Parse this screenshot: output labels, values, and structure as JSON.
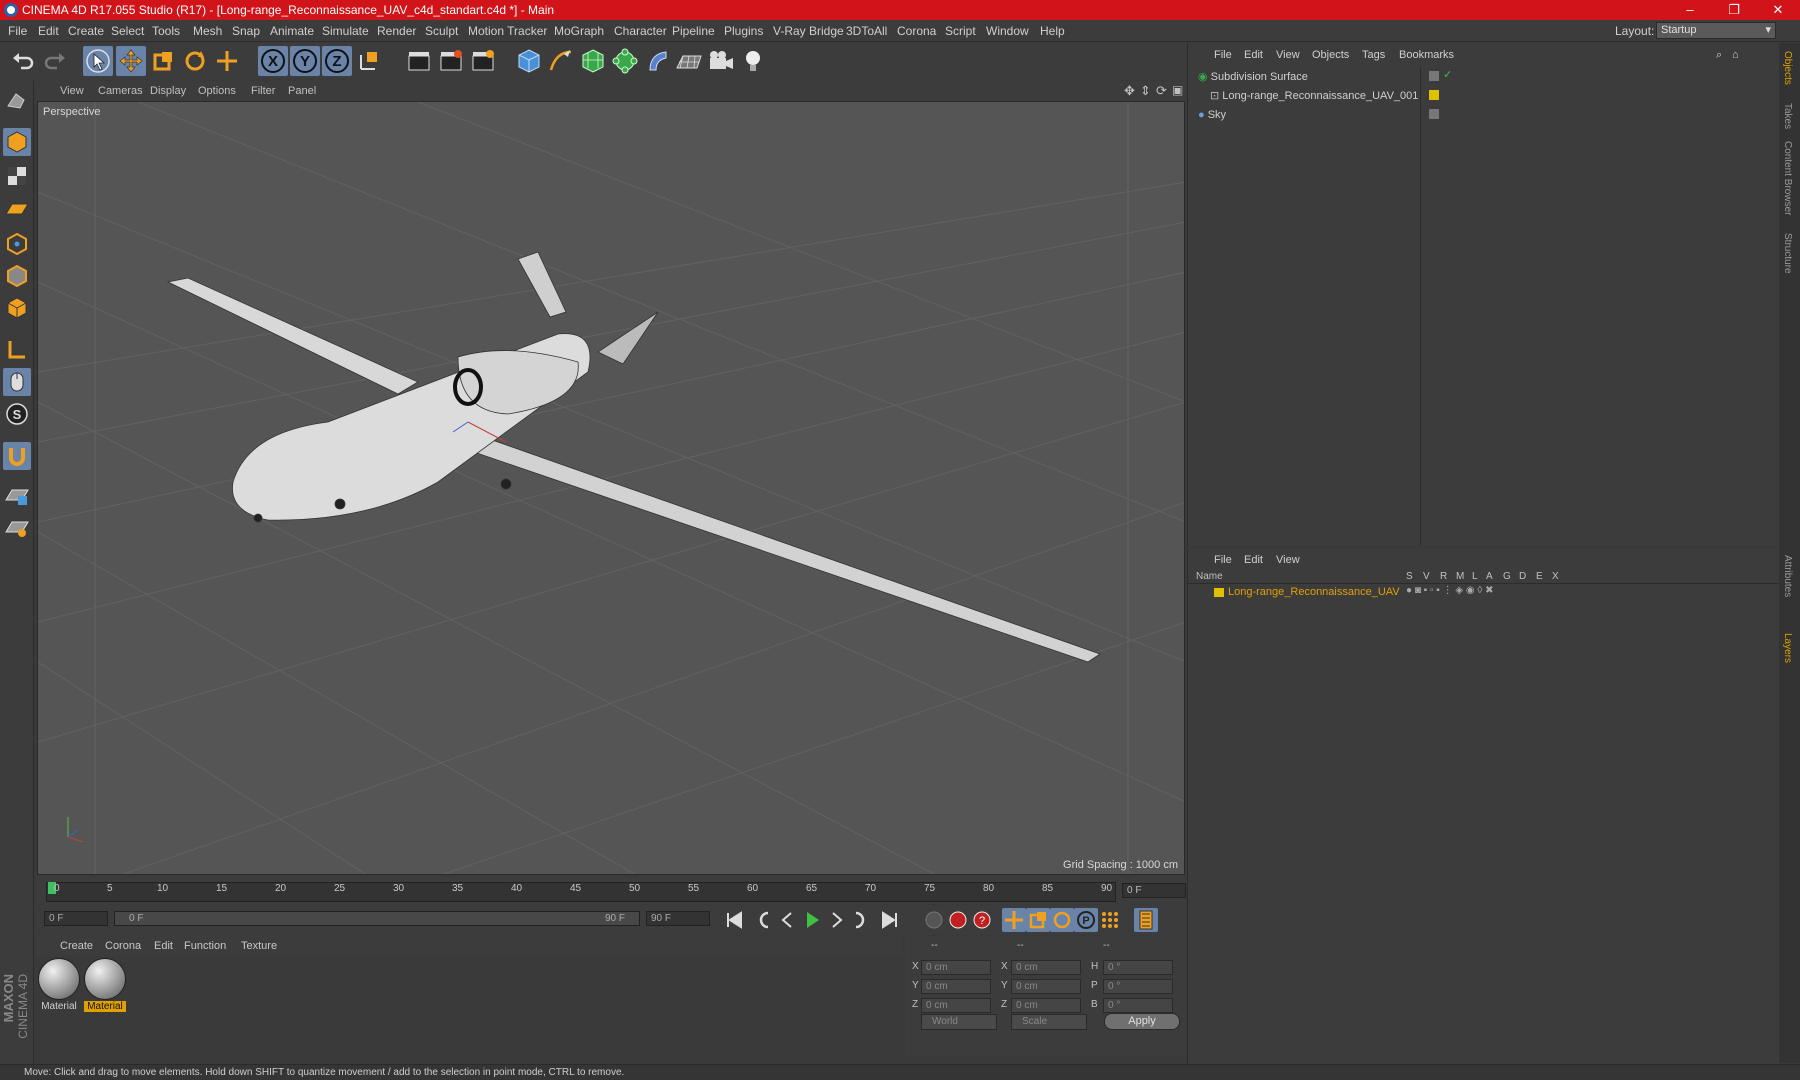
{
  "window": {
    "title": "CINEMA 4D R17.055 Studio (R17) - [Long-range_Reconnaissance_UAV_c4d_standart.c4d *] - Main",
    "minimize": "–",
    "maximize": "❐",
    "close": "✕"
  },
  "menubar": {
    "items": [
      "File",
      "Edit",
      "Create",
      "Select",
      "Tools",
      "Mesh",
      "Snap",
      "Animate",
      "Simulate",
      "Render",
      "Sculpt",
      "Motion Tracker",
      "MoGraph",
      "Character",
      "Pipeline",
      "Plugins",
      "V-Ray Bridge",
      "3DToAll",
      "Corona",
      "Script",
      "Window",
      "Help"
    ],
    "layout_label": "Layout:",
    "layout_value": "Startup"
  },
  "viewport": {
    "menu": [
      "View",
      "Cameras",
      "Display",
      "Options",
      "Filter",
      "Panel"
    ],
    "label": "Perspective",
    "grid_spacing": "Grid Spacing : 1000 cm"
  },
  "timeline": {
    "ticks": [
      "0",
      "5",
      "10",
      "15",
      "20",
      "25",
      "30",
      "35",
      "40",
      "45",
      "50",
      "55",
      "60",
      "65",
      "70",
      "75",
      "80",
      "85",
      "90"
    ],
    "current_frame": "0 F",
    "start_field": "0 F",
    "range_start": "0 F",
    "range_end": "90 F",
    "end_field": "90 F"
  },
  "material_manager": {
    "menu": [
      "Create",
      "Corona",
      "Edit",
      "Function",
      "Texture"
    ],
    "materials": [
      {
        "name": "Material",
        "selected": false
      },
      {
        "name": "Material",
        "selected": true
      }
    ]
  },
  "coordinates": {
    "headers": [
      "--",
      "--",
      "--"
    ],
    "rows": [
      {
        "axis1": "X",
        "v1": "0 cm",
        "axis2": "X",
        "v2": "0 cm",
        "axis3": "H",
        "v3": "0 °"
      },
      {
        "axis1": "Y",
        "v1": "0 cm",
        "axis2": "Y",
        "v2": "0 cm",
        "axis3": "P",
        "v3": "0 °"
      },
      {
        "axis1": "Z",
        "v1": "0 cm",
        "axis2": "Z",
        "v2": "0 cm",
        "axis3": "B",
        "v3": "0 °"
      }
    ],
    "mode1": "World",
    "mode2": "Scale",
    "apply": "Apply"
  },
  "object_manager": {
    "menu": [
      "File",
      "Edit",
      "View",
      "Objects",
      "Tags",
      "Bookmarks"
    ],
    "objects": [
      {
        "name": "Subdivision Surface"
      },
      {
        "name": "Long-range_Reconnaissance_UAV_001"
      },
      {
        "name": "Sky"
      }
    ]
  },
  "layer_manager": {
    "menu": [
      "File",
      "Edit",
      "View"
    ],
    "columns": [
      "Name",
      "S",
      "V",
      "R",
      "M",
      "L",
      "A",
      "G",
      "D",
      "E",
      "X"
    ],
    "layer_name": "Long-range_Reconnaissance_UAV"
  },
  "side_tabs": [
    "Objects",
    "Takes",
    "Content Browser",
    "Structure",
    "Attributes",
    "Layers"
  ],
  "brand": {
    "line1": "MAXON",
    "line2": "CINEMA 4D"
  },
  "status": "Move: Click and drag to move elements. Hold down SHIFT to quantize movement / add to the selection in point mode, CTRL to remove.",
  "colors": {
    "accent": "#6a83a8",
    "title_bar": "#d1141a",
    "layer_color": "#e0c000",
    "selection": "#e0a000"
  }
}
